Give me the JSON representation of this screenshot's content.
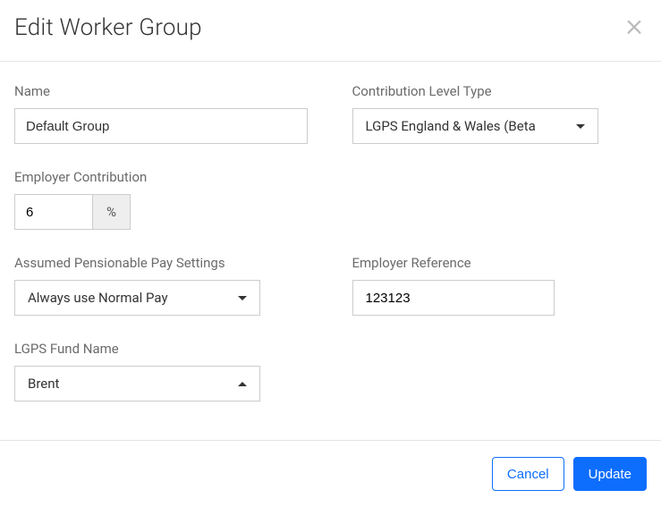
{
  "header": {
    "title": "Edit Worker Group"
  },
  "fields": {
    "name_label": "Name",
    "name_value": "Default Group",
    "contribution_level_type_label": "Contribution Level Type",
    "contribution_level_type_value": "LGPS England & Wales (Beta",
    "employer_contribution_label": "Employer Contribution",
    "employer_contribution_value": "6",
    "employer_contribution_suffix": "%",
    "assumed_pensionable_label": "Assumed Pensionable Pay Settings",
    "assumed_pensionable_value": "Always use Normal Pay",
    "employer_reference_label": "Employer Reference",
    "employer_reference_value": "123123",
    "lgps_fund_name_label": "LGPS Fund Name",
    "lgps_fund_name_value": "Brent"
  },
  "footer": {
    "cancel_label": "Cancel",
    "update_label": "Update"
  }
}
